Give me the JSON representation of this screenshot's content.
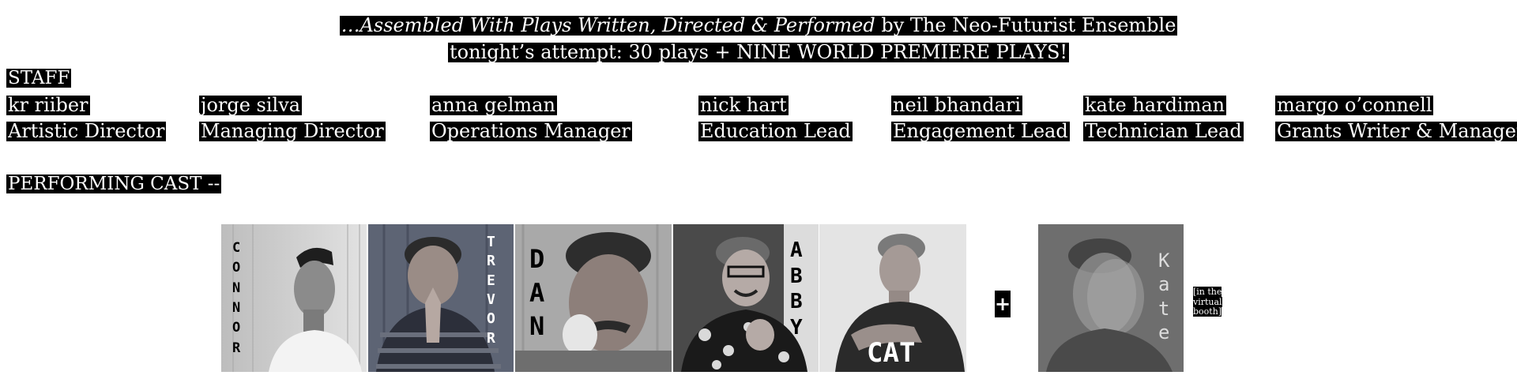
{
  "header": {
    "line1_prefix": "…",
    "line1_italic": "Assembled With Plays Written, Directed & Performed",
    "line1_suffix": " by The Neo-Futurist Ensemble",
    "line2": "tonight’s attempt: 30 plays  +  NINE WORLD PREMIERE PLAYS!"
  },
  "staff": {
    "label": "STAFF",
    "members": [
      {
        "name": "kr  riiber",
        "role": "Artistic Director"
      },
      {
        "name": "jorge silva",
        "role": "Managing Director"
      },
      {
        "name": "anna gelman",
        "role": "Operations Manager"
      },
      {
        "name": "nick hart",
        "role": "Education Lead"
      },
      {
        "name": "neil bhandari",
        "role": "Engagement Lead"
      },
      {
        "name": "kate hardiman",
        "role": "Technician Lead"
      },
      {
        "name": "margo o’connell",
        "role": "Grants Writer & Manager"
      }
    ]
  },
  "cast": {
    "label": "PERFORMING CAST --",
    "members": [
      {
        "name_letters": [
          "C",
          "O",
          "N",
          "N",
          "O",
          "R"
        ]
      },
      {
        "name_letters": [
          "T",
          "R",
          "E",
          "V",
          "O",
          "R"
        ]
      },
      {
        "name_letters": [
          "D",
          "A",
          "N"
        ]
      },
      {
        "name_letters": [
          "A",
          "B",
          "B",
          "Y"
        ]
      },
      {
        "name": "CAT"
      },
      {
        "name_letters": [
          "K",
          "a",
          "t",
          "e"
        ]
      }
    ],
    "plus": "+",
    "virtual_note": "[in the virtual booth]"
  }
}
